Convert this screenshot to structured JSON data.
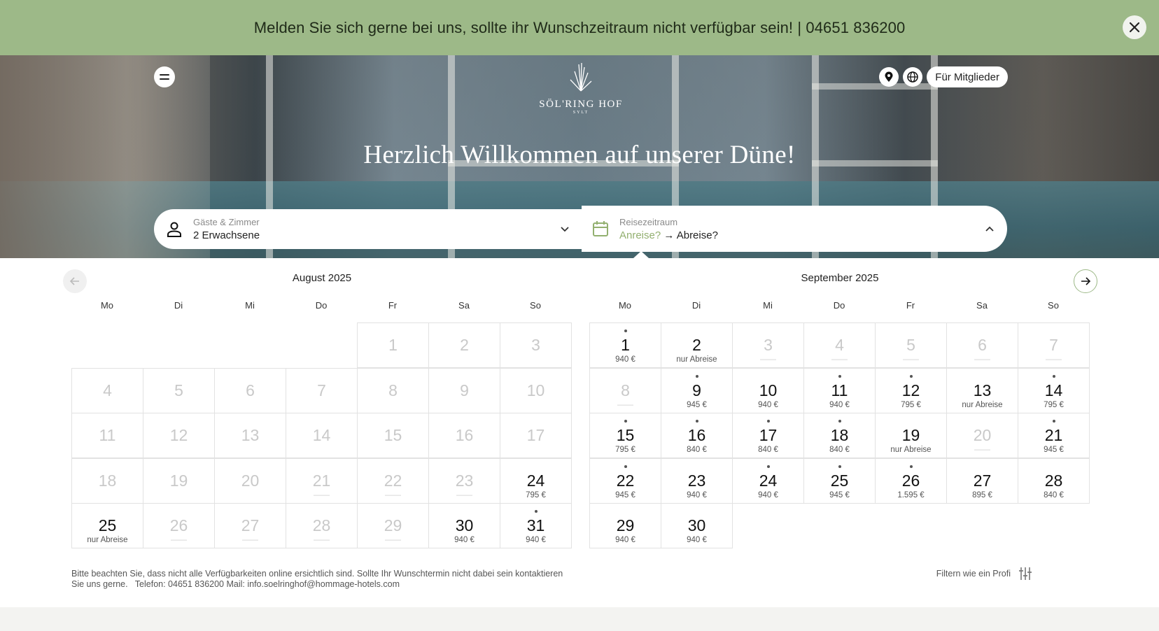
{
  "banner": {
    "text": "Melden Sie sich gerne bei uns, sollte ihr Wunschzeitraum nicht verfügbar sein! | 04651 836200"
  },
  "header": {
    "logo_name": "SÖL'RING HOF",
    "logo_sub": "SYLT",
    "member_label": "Für Mitglieder",
    "icons": [
      "menu-icon",
      "location-pin-icon",
      "globe-icon"
    ]
  },
  "hero": {
    "title": "Herzlich Willkommen auf unserer Düne!"
  },
  "search": {
    "guests_label": "Gäste & Zimmer",
    "guests_value": "2 Erwachsene",
    "dates_label": "Reisezeitraum",
    "arrival": "Anreise?",
    "arrow": "→",
    "departure": "Abreise?"
  },
  "colors": {
    "banner": "#9db988",
    "accent": "#93b070"
  },
  "weekdays": [
    "Mo",
    "Di",
    "Mi",
    "Do",
    "Fr",
    "Sa",
    "So"
  ],
  "months": [
    {
      "title": "August 2025",
      "offset": 4,
      "days": [
        {
          "d": "1",
          "s": "",
          "a": false,
          "dot": false
        },
        {
          "d": "2",
          "s": "",
          "a": false,
          "dot": false
        },
        {
          "d": "3",
          "s": "",
          "a": false,
          "dot": false
        },
        {
          "d": "4",
          "s": "",
          "a": false,
          "dot": false
        },
        {
          "d": "5",
          "s": "",
          "a": false,
          "dot": false
        },
        {
          "d": "6",
          "s": "",
          "a": false,
          "dot": false
        },
        {
          "d": "7",
          "s": "",
          "a": false,
          "dot": false
        },
        {
          "d": "8",
          "s": "",
          "a": false,
          "dot": false
        },
        {
          "d": "9",
          "s": "",
          "a": false,
          "dot": false
        },
        {
          "d": "10",
          "s": "",
          "a": false,
          "dot": false
        },
        {
          "d": "11",
          "s": "",
          "a": false,
          "dot": false
        },
        {
          "d": "12",
          "s": "",
          "a": false,
          "dot": false
        },
        {
          "d": "13",
          "s": "",
          "a": false,
          "dot": false
        },
        {
          "d": "14",
          "s": "",
          "a": false,
          "dot": false
        },
        {
          "d": "15",
          "s": "",
          "a": false,
          "dot": false
        },
        {
          "d": "16",
          "s": "",
          "a": false,
          "dot": false
        },
        {
          "d": "17",
          "s": "",
          "a": false,
          "dot": false
        },
        {
          "d": "18",
          "s": "",
          "a": false,
          "dot": false
        },
        {
          "d": "19",
          "s": "",
          "a": false,
          "dot": false
        },
        {
          "d": "20",
          "s": "",
          "a": false,
          "dot": false
        },
        {
          "d": "21",
          "s": "——",
          "a": false,
          "dot": false
        },
        {
          "d": "22",
          "s": "——",
          "a": false,
          "dot": false
        },
        {
          "d": "23",
          "s": "——",
          "a": false,
          "dot": false
        },
        {
          "d": "24",
          "s": "795 €",
          "a": true,
          "dot": false
        },
        {
          "d": "25",
          "s": "nur Abreise",
          "a": true,
          "dot": false
        },
        {
          "d": "26",
          "s": "——",
          "a": false,
          "dot": false
        },
        {
          "d": "27",
          "s": "——",
          "a": false,
          "dot": false
        },
        {
          "d": "28",
          "s": "——",
          "a": false,
          "dot": false
        },
        {
          "d": "29",
          "s": "——",
          "a": false,
          "dot": false
        },
        {
          "d": "30",
          "s": "940 €",
          "a": true,
          "dot": false
        },
        {
          "d": "31",
          "s": "940 €",
          "a": true,
          "dot": true
        }
      ]
    },
    {
      "title": "September 2025",
      "offset": 0,
      "days": [
        {
          "d": "1",
          "s": "940 €",
          "a": true,
          "dot": true
        },
        {
          "d": "2",
          "s": "nur Abreise",
          "a": true,
          "dot": false
        },
        {
          "d": "3",
          "s": "——",
          "a": false,
          "dot": false
        },
        {
          "d": "4",
          "s": "——",
          "a": false,
          "dot": false
        },
        {
          "d": "5",
          "s": "——",
          "a": false,
          "dot": false
        },
        {
          "d": "6",
          "s": "——",
          "a": false,
          "dot": false
        },
        {
          "d": "7",
          "s": "——",
          "a": false,
          "dot": false
        },
        {
          "d": "8",
          "s": "——",
          "a": false,
          "dot": false
        },
        {
          "d": "9",
          "s": "945 €",
          "a": true,
          "dot": true
        },
        {
          "d": "10",
          "s": "940 €",
          "a": true,
          "dot": false
        },
        {
          "d": "11",
          "s": "940 €",
          "a": true,
          "dot": true
        },
        {
          "d": "12",
          "s": "795 €",
          "a": true,
          "dot": true
        },
        {
          "d": "13",
          "s": "nur Abreise",
          "a": true,
          "dot": false
        },
        {
          "d": "14",
          "s": "795 €",
          "a": true,
          "dot": true
        },
        {
          "d": "15",
          "s": "795 €",
          "a": true,
          "dot": true
        },
        {
          "d": "16",
          "s": "840 €",
          "a": true,
          "dot": true
        },
        {
          "d": "17",
          "s": "840 €",
          "a": true,
          "dot": true
        },
        {
          "d": "18",
          "s": "840 €",
          "a": true,
          "dot": true
        },
        {
          "d": "19",
          "s": "nur Abreise",
          "a": true,
          "dot": false
        },
        {
          "d": "20",
          "s": "——",
          "a": false,
          "dot": false
        },
        {
          "d": "21",
          "s": "945 €",
          "a": true,
          "dot": true
        },
        {
          "d": "22",
          "s": "945 €",
          "a": true,
          "dot": true
        },
        {
          "d": "23",
          "s": "940 €",
          "a": true,
          "dot": false
        },
        {
          "d": "24",
          "s": "940 €",
          "a": true,
          "dot": true
        },
        {
          "d": "25",
          "s": "945 €",
          "a": true,
          "dot": true
        },
        {
          "d": "26",
          "s": "1.595 €",
          "a": true,
          "dot": true
        },
        {
          "d": "27",
          "s": "895 €",
          "a": true,
          "dot": false
        },
        {
          "d": "28",
          "s": "840 €",
          "a": true,
          "dot": false
        },
        {
          "d": "29",
          "s": "940 €",
          "a": true,
          "dot": false
        },
        {
          "d": "30",
          "s": "940 €",
          "a": true,
          "dot": false
        }
      ]
    }
  ],
  "footer": {
    "note_line1": "Bitte beachten Sie, dass nicht alle Verfügbarkeiten online ersichtlich sind. Sollte Ihr Wunschtermin nicht dabei sein kontaktieren",
    "note_line2": "Sie uns gerne.   Telefon: 04651 836200 Mail: info.soelringhof@hommage-hotels.com",
    "filter_label": "Filtern wie ein Profi"
  }
}
